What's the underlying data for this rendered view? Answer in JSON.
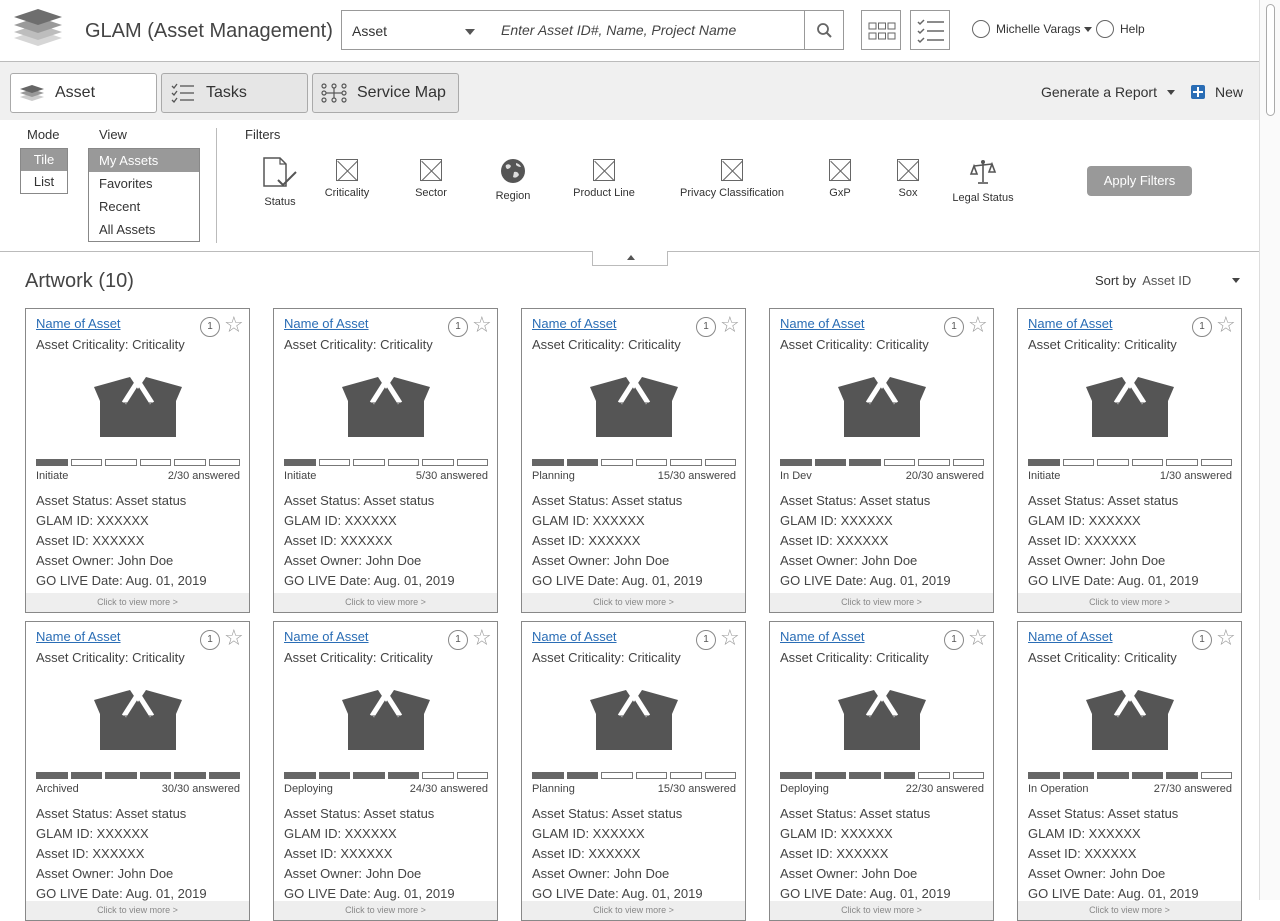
{
  "app": {
    "title": "GLAM (Asset Management)"
  },
  "search": {
    "type_value": "Asset",
    "placeholder": "Enter Asset ID#, Name, Project Name"
  },
  "user": {
    "name": "Michelle Varags",
    "help": "Help"
  },
  "tabs": [
    {
      "label": "Asset",
      "icon": "layers-icon"
    },
    {
      "label": "Tasks",
      "icon": "checklist-icon"
    },
    {
      "label": "Service Map",
      "icon": "service-map-icon"
    }
  ],
  "actions": {
    "report": "Generate a Report",
    "new": "New"
  },
  "mode": {
    "label": "Mode",
    "options": [
      "Tile",
      "List"
    ],
    "selected": "Tile"
  },
  "view": {
    "label": "View",
    "options": [
      "My Assets",
      "Favorites",
      "Recent",
      "All Assets"
    ],
    "selected": "My Assets"
  },
  "filters": {
    "label": "Filters",
    "items": [
      {
        "label": "Status",
        "icon": "status-doc-icon"
      },
      {
        "label": "Criticality",
        "icon": "placeholder-icon"
      },
      {
        "label": "Sector",
        "icon": "placeholder-icon"
      },
      {
        "label": "Region",
        "icon": "globe-icon"
      },
      {
        "label": "Product Line",
        "icon": "placeholder-icon"
      },
      {
        "label": "Privacy Classification",
        "icon": "placeholder-icon"
      },
      {
        "label": "GxP",
        "icon": "placeholder-icon"
      },
      {
        "label": "Sox",
        "icon": "placeholder-icon"
      },
      {
        "label": "Legal Status",
        "icon": "scales-icon"
      }
    ],
    "apply": "Apply Filters"
  },
  "section": {
    "title": "Artwork (10)",
    "sort_label": "Sort by",
    "sort_value": "Asset ID"
  },
  "cards": [
    {
      "name": "Name of Asset",
      "badge": "1",
      "criticality": "Asset Criticality: Criticality",
      "phase": "Initiate",
      "answered": "2/30 answered",
      "filled": 1,
      "status": "Asset Status: Asset status",
      "glam_id": "GLAM ID: XXXXXX",
      "asset_id": "Asset ID: XXXXXX",
      "owner": "Asset Owner: John Doe",
      "go_live": "GO LIVE Date: Aug. 01, 2019",
      "more": "Click to view more >"
    },
    {
      "name": "Name of Asset",
      "badge": "1",
      "criticality": "Asset Criticality: Criticality",
      "phase": "Initiate",
      "answered": "5/30 answered",
      "filled": 1,
      "status": "Asset Status: Asset status",
      "glam_id": "GLAM ID: XXXXXX",
      "asset_id": "Asset ID: XXXXXX",
      "owner": "Asset Owner: John Doe",
      "go_live": "GO LIVE Date: Aug. 01, 2019",
      "more": "Click to view more >"
    },
    {
      "name": "Name of Asset",
      "badge": "1",
      "criticality": "Asset Criticality: Criticality",
      "phase": "Planning",
      "answered": "15/30 answered",
      "filled": 2,
      "status": "Asset Status: Asset status",
      "glam_id": "GLAM ID: XXXXXX",
      "asset_id": "Asset ID: XXXXXX",
      "owner": "Asset Owner: John Doe",
      "go_live": "GO LIVE Date: Aug. 01, 2019",
      "more": "Click to view more >"
    },
    {
      "name": "Name of Asset",
      "badge": "1",
      "criticality": "Asset Criticality: Criticality",
      "phase": "In Dev",
      "answered": "20/30 answered",
      "filled": 3,
      "status": "Asset Status: Asset status",
      "glam_id": "GLAM ID: XXXXXX",
      "asset_id": "Asset ID: XXXXXX",
      "owner": "Asset Owner: John Doe",
      "go_live": "GO LIVE Date: Aug. 01, 2019",
      "more": "Click to view more >"
    },
    {
      "name": "Name of Asset",
      "badge": "1",
      "criticality": "Asset Criticality: Criticality",
      "phase": "Initiate",
      "answered": "1/30 answered",
      "filled": 1,
      "status": "Asset Status: Asset status",
      "glam_id": "GLAM ID: XXXXXX",
      "asset_id": "Asset ID: XXXXXX",
      "owner": "Asset Owner: John Doe",
      "go_live": "GO LIVE Date: Aug. 01, 2019",
      "more": "Click to view more >"
    },
    {
      "name": "Name of Asset",
      "badge": "1",
      "criticality": "Asset Criticality: Criticality",
      "phase": "Archived",
      "answered": "30/30 answered",
      "filled": 6,
      "status": "Asset Status: Asset status",
      "glam_id": "GLAM ID: XXXXXX",
      "asset_id": "Asset ID: XXXXXX",
      "owner": "Asset Owner: John Doe",
      "go_live": "GO LIVE Date: Aug. 01, 2019",
      "more": "Click to view more >"
    },
    {
      "name": "Name of Asset",
      "badge": "1",
      "criticality": "Asset Criticality: Criticality",
      "phase": "Deploying",
      "answered": "24/30 answered",
      "filled": 4,
      "status": "Asset Status: Asset status",
      "glam_id": "GLAM ID: XXXXXX",
      "asset_id": "Asset ID: XXXXXX",
      "owner": "Asset Owner: John Doe",
      "go_live": "GO LIVE Date: Aug. 01, 2019",
      "more": "Click to view more >"
    },
    {
      "name": "Name of Asset",
      "badge": "1",
      "criticality": "Asset Criticality: Criticality",
      "phase": "Planning",
      "answered": "15/30 answered",
      "filled": 2,
      "status": "Asset Status: Asset status",
      "glam_id": "GLAM ID: XXXXXX",
      "asset_id": "Asset ID: XXXXXX",
      "owner": "Asset Owner: John Doe",
      "go_live": "GO LIVE Date: Aug. 01, 2019",
      "more": "Click to view more >"
    },
    {
      "name": "Name of Asset",
      "badge": "1",
      "criticality": "Asset Criticality: Criticality",
      "phase": "Deploying",
      "answered": "22/30 answered",
      "filled": 4,
      "status": "Asset Status: Asset status",
      "glam_id": "GLAM ID: XXXXXX",
      "asset_id": "Asset ID: XXXXXX",
      "owner": "Asset Owner: John Doe",
      "go_live": "GO LIVE Date: Aug. 01, 2019",
      "more": "Click to view more >"
    },
    {
      "name": "Name of Asset",
      "badge": "1",
      "criticality": "Asset Criticality: Criticality",
      "phase": "In Operation",
      "answered": "27/30 answered",
      "filled": 5,
      "status": "Asset Status: Asset status",
      "glam_id": "GLAM ID: XXXXXX",
      "asset_id": "Asset ID: XXXXXX",
      "owner": "Asset Owner: John Doe",
      "go_live": "GO LIVE Date: Aug. 01, 2019",
      "more": "Click to view more >"
    }
  ],
  "colors": {
    "link": "#2a6db5",
    "new_icon": "#2a6db5",
    "progress_fill": "#666666",
    "selected_option": "#999999"
  }
}
